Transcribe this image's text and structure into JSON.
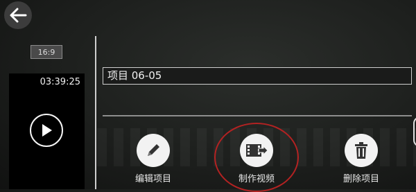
{
  "header": {
    "back_icon": "arrow-left-icon"
  },
  "preview": {
    "aspect_ratio": "16:9",
    "duration": "03:39:25",
    "play_icon": "play-icon"
  },
  "project": {
    "title": "项目 06-05"
  },
  "actions": [
    {
      "label": "编辑项目",
      "icon": "pencil-icon"
    },
    {
      "label": "制作视频",
      "icon": "film-export-icon"
    },
    {
      "label": "删除项目",
      "icon": "trash-icon"
    }
  ],
  "colors": {
    "highlight_ring": "#b32222"
  }
}
